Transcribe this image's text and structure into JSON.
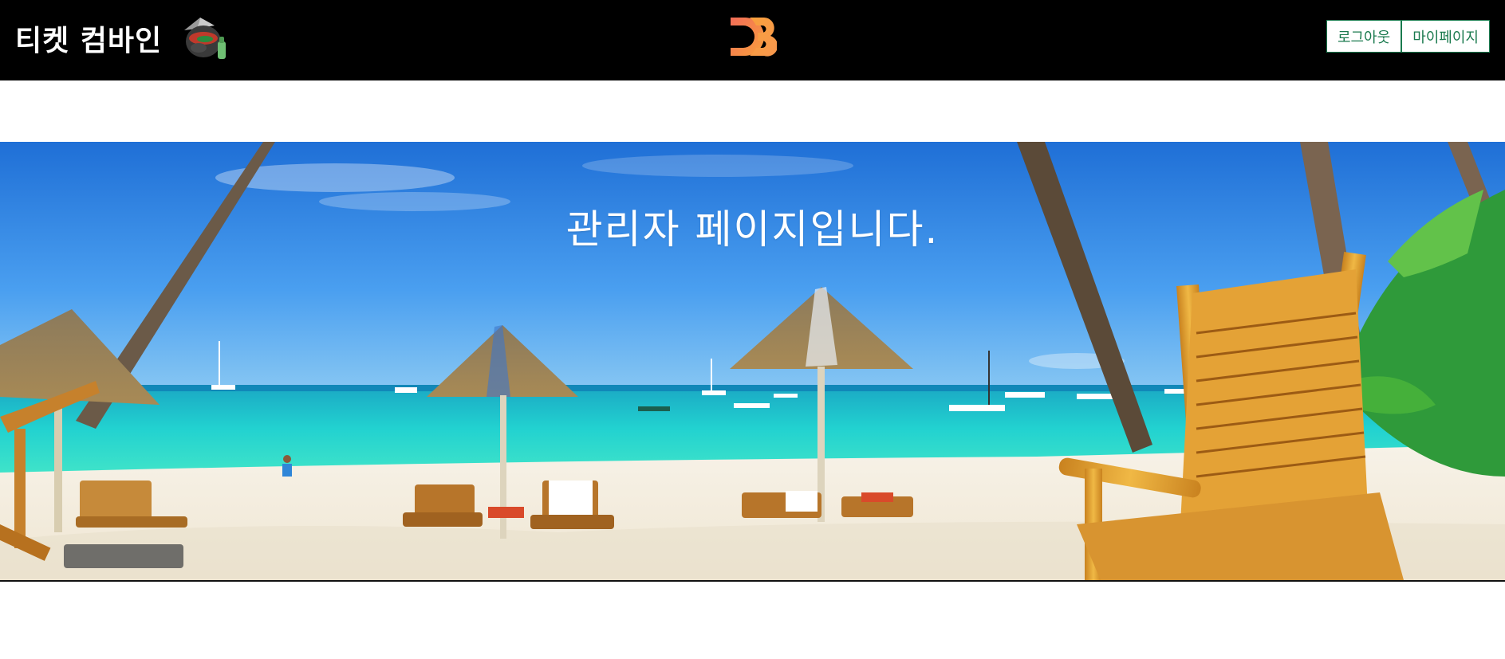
{
  "header": {
    "brand_text": "티켓 컴바인",
    "mascot_icon": "mascot-icon",
    "logo_icon": "d3-logo-icon",
    "logout_label": "로그아웃",
    "mypage_label": "마이페이지",
    "accent_color": "#1a7a4e",
    "background_color": "#000000"
  },
  "hero": {
    "title": "관리자 페이지입니다.",
    "image_subject": "tropical-beach-banner"
  }
}
